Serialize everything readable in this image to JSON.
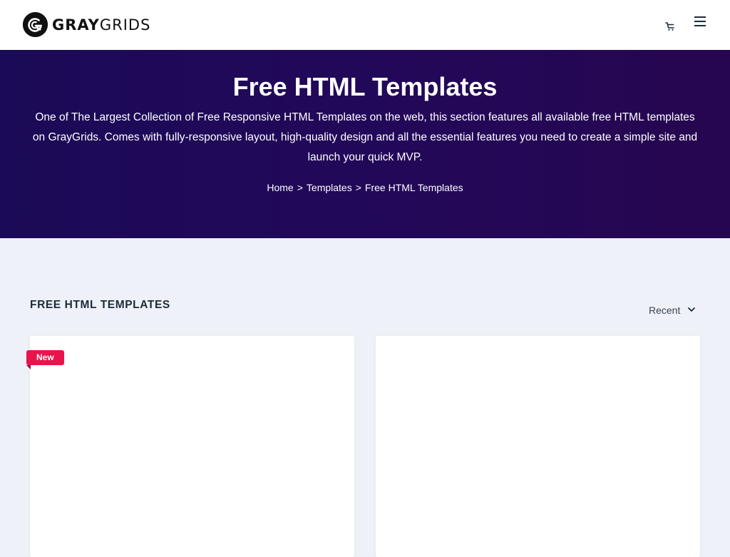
{
  "header": {
    "logo_bold": "GRAY",
    "logo_light": "GRIDS",
    "cart_icon": "cart-icon",
    "menu_icon": "hamburger-menu-icon"
  },
  "hero": {
    "title": "Free HTML Templates",
    "description": "One of The Largest Collection of Free Responsive HTML Templates on the web, this section features all available free HTML templates on GrayGrids. Comes with fully-responsive layout, high-quality design and all the essential features you need to create a simple site and launch your quick MVP.",
    "breadcrumb": [
      {
        "label": "Home"
      },
      {
        "label": "Templates"
      },
      {
        "label": "Free HTML Templates"
      }
    ],
    "breadcrumb_separator": ">"
  },
  "section": {
    "title": "FREE HTML TEMPLATES",
    "sort": {
      "selected": "Recent",
      "icon": "chevron-down-icon"
    }
  },
  "cards": [
    {
      "badge": "New"
    },
    {
      "badge": ""
    }
  ],
  "colors": {
    "hero_bg": "#1b0a57",
    "badge_bg": "#e8144b",
    "page_bg": "#eef1f7"
  }
}
